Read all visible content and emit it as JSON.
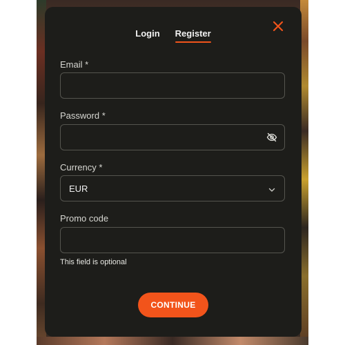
{
  "tabs": [
    {
      "label": "Login",
      "active": false
    },
    {
      "label": "Register",
      "active": true
    }
  ],
  "accent_color": "#f2541b",
  "close_icon": "close-icon",
  "form": {
    "email": {
      "label": "Email *",
      "value": ""
    },
    "password": {
      "label": "Password *",
      "value": "",
      "icon": "eye-off-icon"
    },
    "currency": {
      "label": "Currency *",
      "selected": "EUR",
      "icon": "chevron-down-icon"
    },
    "promo": {
      "label": "Promo code",
      "value": "",
      "hint": "This field is optional"
    }
  },
  "continue_label": "CONTINUE"
}
